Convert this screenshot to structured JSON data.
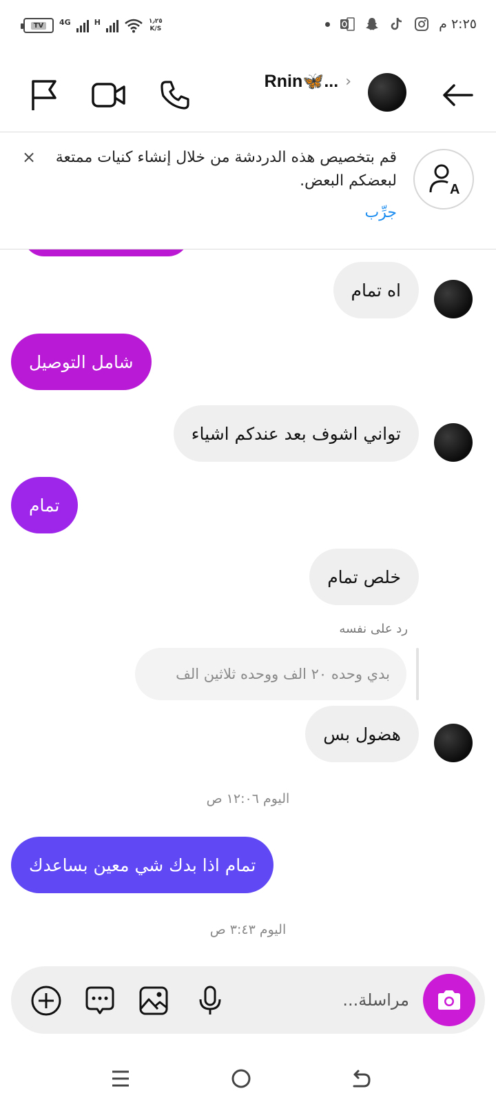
{
  "status_bar": {
    "battery_label": "TV",
    "network_4g": "4G",
    "network_h": "H",
    "speed_value": "١٫٢٥",
    "speed_unit": "K/S",
    "time": "٢:٢٥ م",
    "icons": [
      "instagram-icon",
      "tiktok-icon",
      "snapchat-icon",
      "outlook-icon",
      "dot"
    ]
  },
  "header": {
    "title": "Rnin🦋...",
    "icons": [
      "back-arrow-icon",
      "avatar",
      "phone-icon",
      "video-icon",
      "flag-icon"
    ]
  },
  "banner": {
    "text": "قم بتخصيص هذه الدردشة من خلال إنشاء كنيات ممتعة لبعضكم البعض.",
    "cta": "جرِّب",
    "close": "×",
    "icon": "person-nickname-icon"
  },
  "messages": [
    {
      "side": "in",
      "text": "اه تمام"
    },
    {
      "side": "out",
      "text": "شامل التوصيل",
      "color": "#b81ad6"
    },
    {
      "side": "in",
      "text": "تواني اشوف بعد عندكم اشياء"
    },
    {
      "side": "out",
      "text": "تمام",
      "color": "#9e26ea"
    },
    {
      "side": "in",
      "text": "خلص تمام"
    },
    {
      "side": "reply",
      "label": "رد على نفسه",
      "quote": "بدي وحده ٢٠ الف ووحده ثلاثين الف"
    },
    {
      "side": "in",
      "text": "هضول بس"
    },
    {
      "side": "timestamp",
      "text": "اليوم ١٢:٠٦ ص"
    },
    {
      "side": "out",
      "text": "تمام اذا بدك شي معين بساعدك",
      "color": "#6048f4"
    },
    {
      "side": "timestamp",
      "text": "اليوم ٣:٤٣ ص"
    }
  ],
  "composer": {
    "placeholder": "مراسلة...",
    "icons": [
      "camera-icon",
      "microphone-icon",
      "gallery-icon",
      "chat-bubble-icon",
      "plus-icon"
    ],
    "camera_color": "#cc1bd6"
  },
  "nav_bar": {
    "icons": [
      "back-nav-icon",
      "home-circle-icon",
      "menu-lines-icon"
    ]
  }
}
